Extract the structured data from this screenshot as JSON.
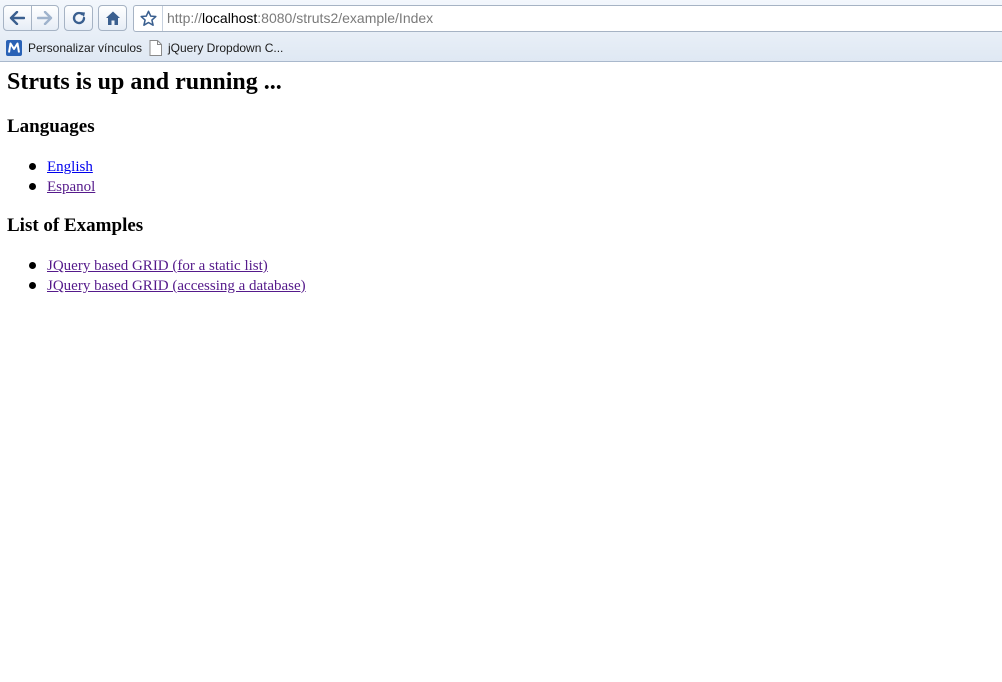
{
  "browser": {
    "url_prefix": "http://",
    "url_host": "localhost",
    "url_rest": ":8080/struts2/example/Index",
    "bookmarks": [
      {
        "label": "Personalizar vínculos",
        "icon": "mail-m-icon"
      },
      {
        "label": "jQuery Dropdown C...",
        "icon": "page-icon"
      }
    ]
  },
  "page": {
    "title": "Struts is up and running ...",
    "languages_heading": "Languages",
    "languages": [
      {
        "label": "English",
        "state": "unvisited"
      },
      {
        "label": "Espanol",
        "state": "visited"
      }
    ],
    "examples_heading": "List of Examples",
    "examples": [
      {
        "label": "JQuery based GRID (for a static list)",
        "state": "visited"
      },
      {
        "label": "JQuery based GRID (accessing a database)",
        "state": "visited"
      }
    ]
  },
  "colors": {
    "link_unvisited": "#0000ee",
    "link_visited": "#551a8b",
    "chrome_bg": "#dfe8f3"
  }
}
